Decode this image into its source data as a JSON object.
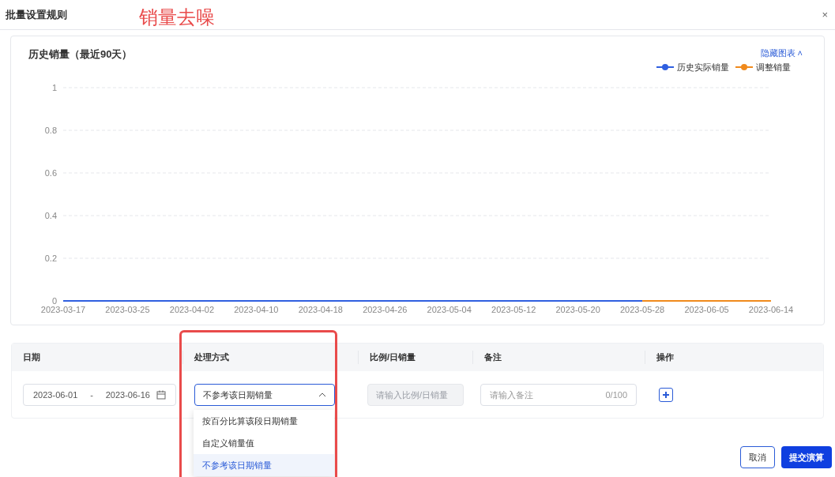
{
  "dialog": {
    "title": "批量设置规则",
    "annotation": "销量去噪",
    "close_glyph": "×"
  },
  "chart_panel": {
    "title": "历史销量（最近90天）",
    "toggle_link": "隐藏图表",
    "toggle_glyph": "˄",
    "chart_data": {
      "type": "line",
      "x": [
        "2023-03-17",
        "2023-03-25",
        "2023-04-02",
        "2023-04-10",
        "2023-04-18",
        "2023-04-26",
        "2023-05-04",
        "2023-05-12",
        "2023-05-20",
        "2023-05-28",
        "2023-06-05",
        "2023-06-14"
      ],
      "series": [
        {
          "name": "历史实际销量",
          "color": "#2f5fe0",
          "values": [
            0,
            0,
            0,
            0,
            0,
            0,
            0,
            0,
            0,
            0,
            null,
            null
          ]
        },
        {
          "name": "调整销量",
          "color": "#f08a1c",
          "values": [
            null,
            null,
            null,
            null,
            null,
            null,
            null,
            null,
            null,
            0,
            0,
            0
          ]
        }
      ],
      "ylim": [
        0,
        1
      ],
      "yticks": [
        0,
        0.2,
        0.4,
        0.6,
        0.8,
        1
      ],
      "grid": true
    }
  },
  "rules_table": {
    "columns": [
      "日期",
      "处理方式",
      "比例/日销量",
      "备注",
      "操作"
    ],
    "rows": [
      {
        "date_start": "2023-06-01",
        "date_separator": "-",
        "date_end": "2023-06-16",
        "method": "不参考该日期销量",
        "method_expanded": true,
        "ratio_placeholder": "请输入比例/日销量",
        "ratio_disabled": true,
        "note_placeholder": "请输入备注",
        "note_counter": "0/100"
      }
    ]
  },
  "method_options": [
    {
      "label": "按百分比算该段日期销量",
      "selected": false
    },
    {
      "label": "自定义销量值",
      "selected": false
    },
    {
      "label": "不参考该日期销量",
      "selected": true
    }
  ],
  "buttons": [
    {
      "label": "取消",
      "kind": "secondary"
    },
    {
      "label": "提交演算",
      "kind": "primary"
    }
  ]
}
